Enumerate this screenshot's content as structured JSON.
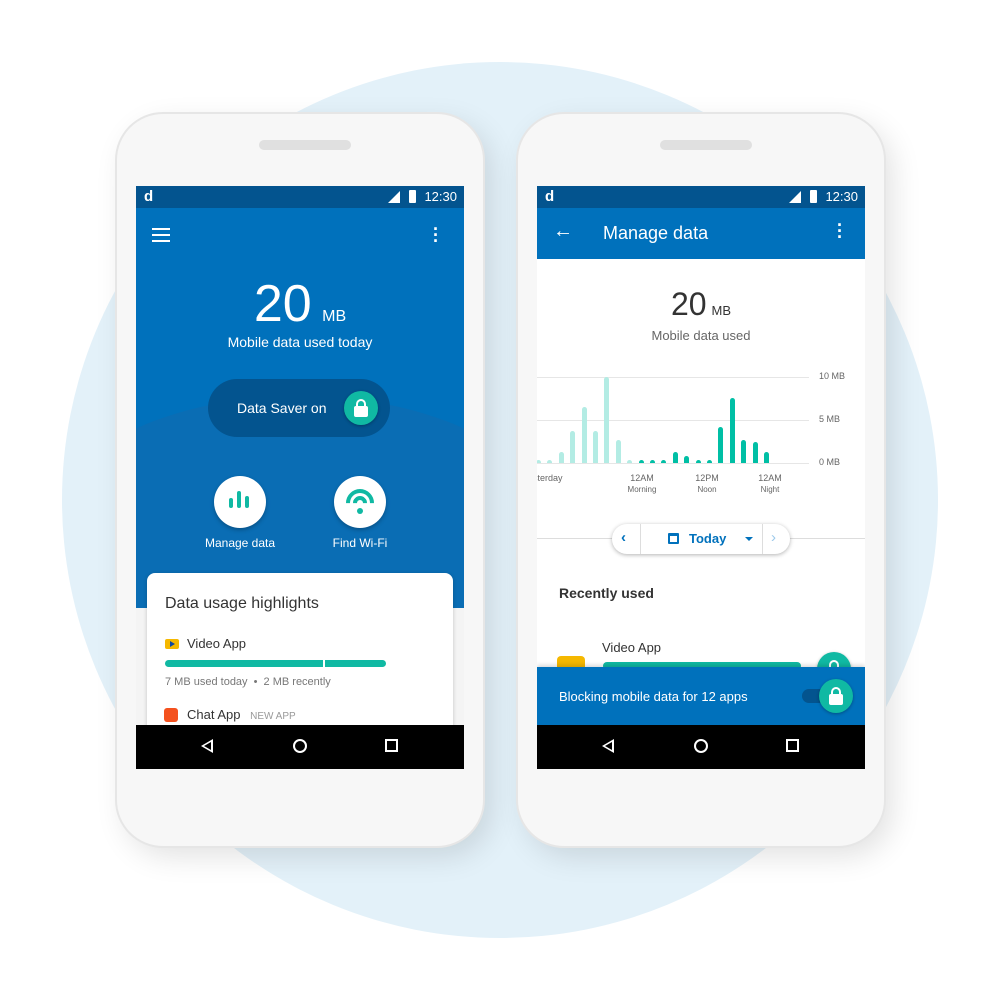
{
  "status_bar": {
    "time": "12:30",
    "logo": "d"
  },
  "home": {
    "amount": "20",
    "unit": "MB",
    "caption": "Mobile data used today",
    "saver_label": "Data Saver on",
    "actions": [
      {
        "label": "Manage data",
        "icon": "bar-chart-icon"
      },
      {
        "label": "Find Wi-Fi",
        "icon": "wifi-icon"
      }
    ],
    "card": {
      "title": "Data usage highlights",
      "apps": [
        {
          "name": "Video App",
          "usage": "7 MB used today",
          "dot": "•",
          "recent": "2 MB recently",
          "today_mb": 7,
          "recent_mb": 2
        },
        {
          "name": "Chat App",
          "badge": "NEW APP"
        }
      ]
    }
  },
  "manage": {
    "title": "Manage data",
    "amount": "20",
    "unit": "MB",
    "caption": "Mobile data used",
    "period": "Today",
    "section": "Recently used",
    "app": "Video App",
    "banner": "Blocking mobile data for 12 apps"
  },
  "chart_data": {
    "type": "bar",
    "y_ticks": [
      "10 MB",
      "5 MB",
      "0 MB"
    ],
    "ylim": [
      0,
      10
    ],
    "x_labels": [
      {
        "time": "sterday",
        "sub": ""
      },
      {
        "time": "12AM",
        "sub": "Morning"
      },
      {
        "time": "12PM",
        "sub": "Noon"
      },
      {
        "time": "12AM",
        "sub": "Night"
      }
    ],
    "series": [
      {
        "values": [
          0.2,
          0.2,
          1.3,
          3.7,
          6.5,
          3.7,
          10,
          2.7,
          0.2
        ],
        "color": "#b3ece4"
      },
      {
        "values": [
          0.3,
          0.3,
          0.3,
          1.3,
          0.8,
          0.3,
          0.3,
          4.2,
          7.6,
          2.7,
          2.5,
          1.3
        ],
        "color": "#00bfa5"
      }
    ]
  },
  "colors": {
    "primary": "#0071bc",
    "status": "#03548f",
    "accent": "#00bfa5"
  }
}
